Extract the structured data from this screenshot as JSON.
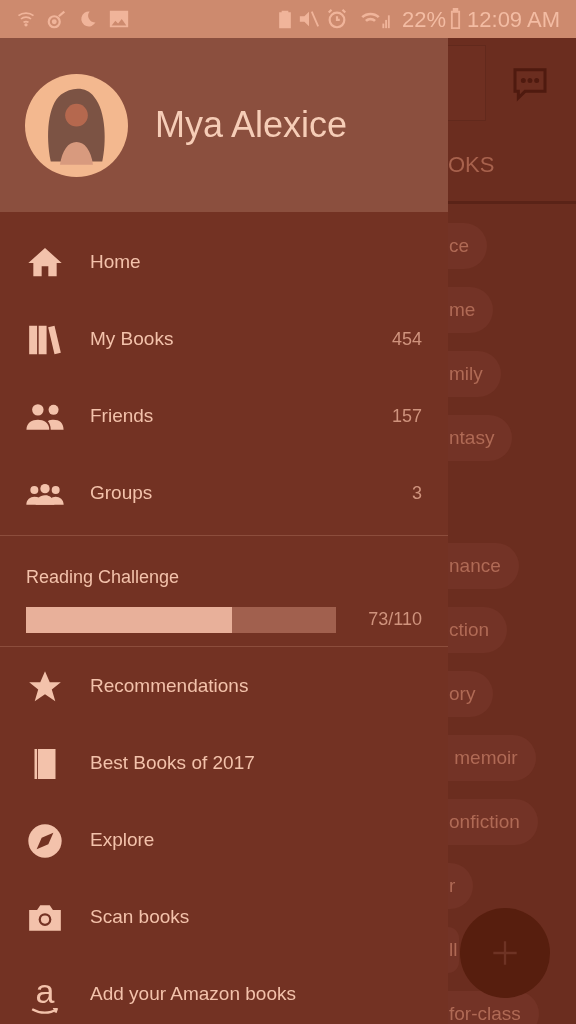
{
  "status_bar": {
    "battery_percent": "22%",
    "time": "12:09 AM"
  },
  "drawer": {
    "user_name": "Mya Alexice",
    "menu": [
      {
        "label": "Home"
      },
      {
        "label": "My Books",
        "count": "454"
      },
      {
        "label": "Friends",
        "count": "157"
      },
      {
        "label": "Groups",
        "count": "3"
      }
    ],
    "reading_challenge": {
      "title": "Reading Challenge",
      "level": 0.664,
      "reading": "73/110"
    },
    "links": [
      {
        "label": "Recommendations"
      },
      {
        "label": "Best Books of 2017"
      },
      {
        "label": "Explore"
      },
      {
        "label": "Scan books"
      },
      {
        "label": "Add your Amazon books",
        "glyph": "a"
      }
    ]
  },
  "background": {
    "tab": "OKS",
    "chip_groups": [
      [
        "ce",
        "me",
        "mily",
        "ntasy"
      ],
      [
        "nance",
        "ction",
        "ory",
        " memoir",
        "onfiction",
        "r",
        "ll",
        "for-class"
      ]
    ]
  }
}
